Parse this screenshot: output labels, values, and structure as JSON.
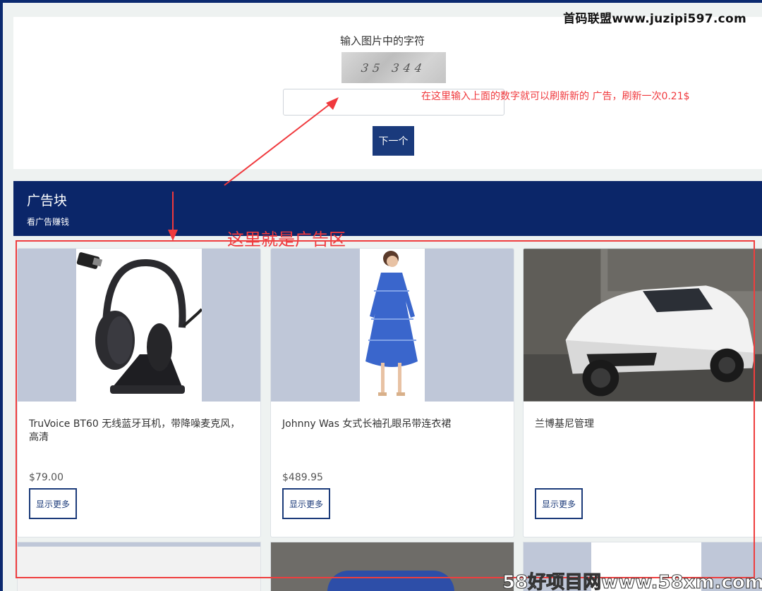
{
  "watermark_top": "首码联盟www.juzipi597.com",
  "captcha": {
    "prompt": "输入图片中的字符",
    "image_text": "35 344",
    "input_value": "",
    "next_label": "下一个",
    "hint": "在这里输入上面的数字就可以刷新新的 广告，刷新一次0.21$"
  },
  "ad_block": {
    "title": "广告块",
    "subtitle": "看广告赚钱",
    "area_label": "这里就是广告区"
  },
  "cards": [
    {
      "title": "TruVoice BT60 无线蓝牙耳机，带降噪麦克风，高清",
      "price": "$79.00",
      "button": "显示更多",
      "image": "headset-image"
    },
    {
      "title": "Johnny Was 女式长袖孔眼吊带连衣裙",
      "price": "$489.95",
      "button": "显示更多",
      "image": "dress-image"
    },
    {
      "title": "兰博基尼管理",
      "price": "",
      "button": "显示更多",
      "image": "car-image"
    }
  ],
  "watermark_bottom": "58好项目网www.58xm.com",
  "colors": {
    "navy": "#0b2669",
    "annotation_red": "#f0393d",
    "button_blue": "#1a3a7c"
  }
}
